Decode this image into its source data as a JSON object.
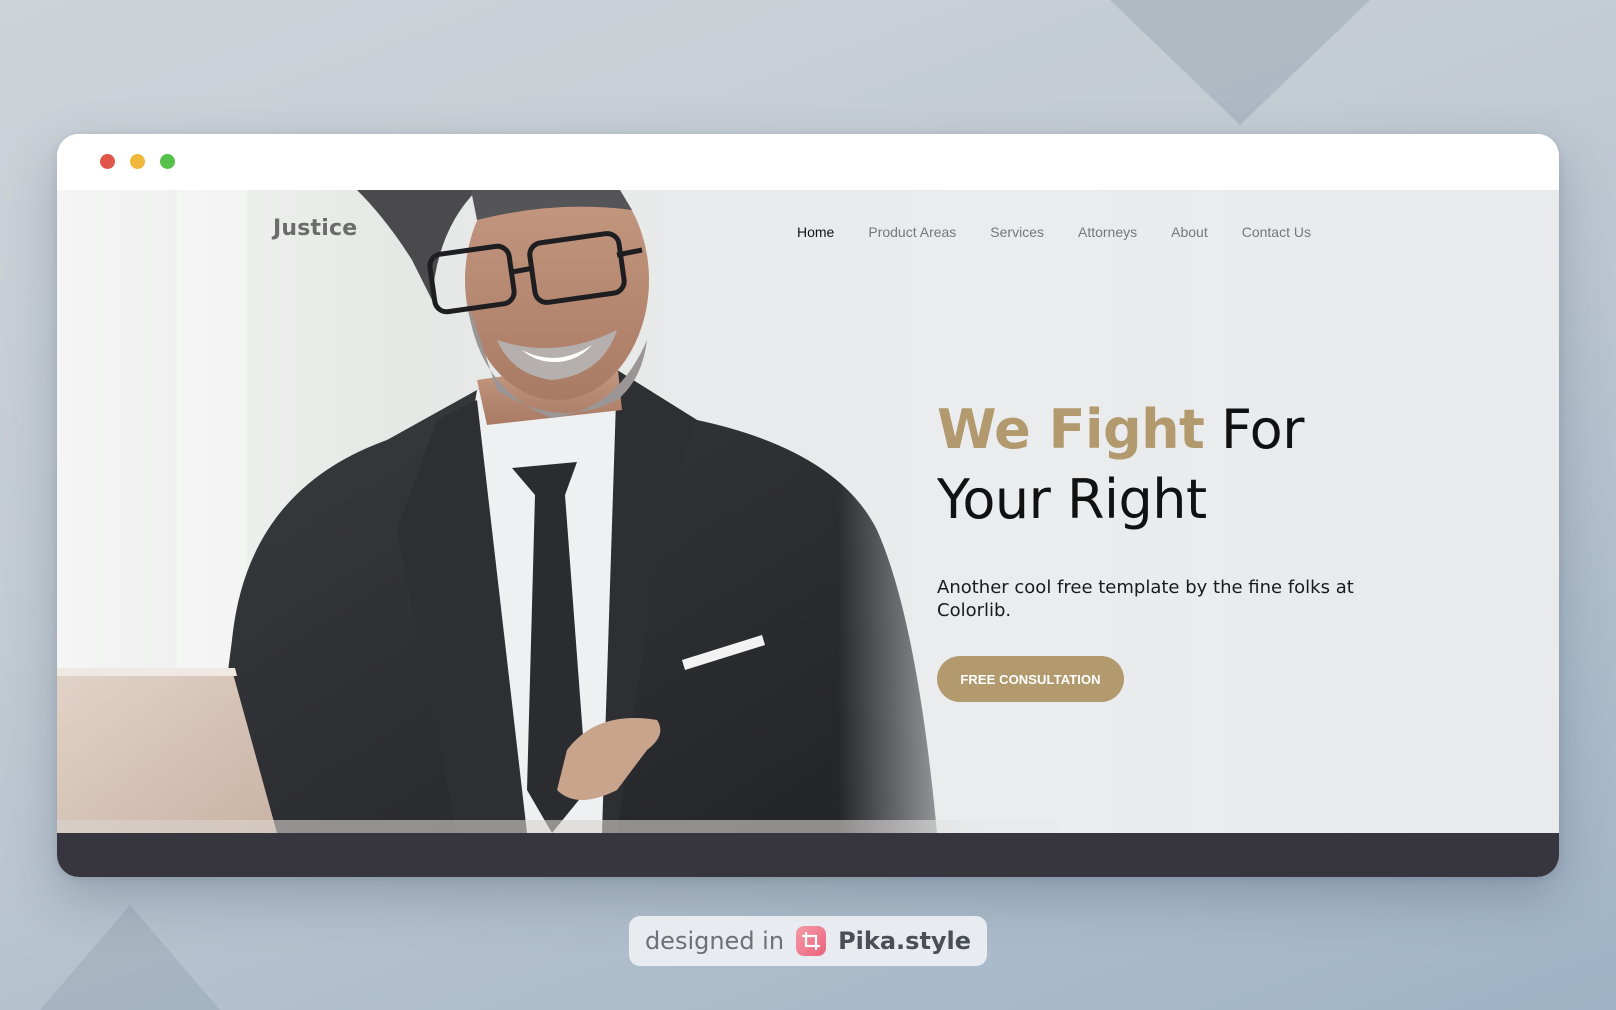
{
  "colors": {
    "accent": "#b29a6e",
    "traffic_red": "#e0564a",
    "traffic_yellow": "#f0b73b",
    "traffic_green": "#57c24a",
    "footer_dark": "#37363f"
  },
  "site": {
    "logo": "Justice"
  },
  "nav": {
    "items": [
      {
        "label": "Home",
        "active": true
      },
      {
        "label": "Product Areas",
        "active": false
      },
      {
        "label": "Services",
        "active": false
      },
      {
        "label": "Attorneys",
        "active": false
      },
      {
        "label": "About",
        "active": false
      },
      {
        "label": "Contact Us",
        "active": false
      }
    ]
  },
  "hero": {
    "headline_accent": "We Fight",
    "headline_rest_1": " For",
    "headline_rest_2": "Your Right",
    "subtext": "Another cool free template by the fine folks at Colorlib.",
    "cta_label": "FREE CONSULTATION",
    "photo_icon": "businessman-photo"
  },
  "badge": {
    "prefix": "designed in",
    "brand": "Pika.style",
    "icon": "crop-icon"
  }
}
